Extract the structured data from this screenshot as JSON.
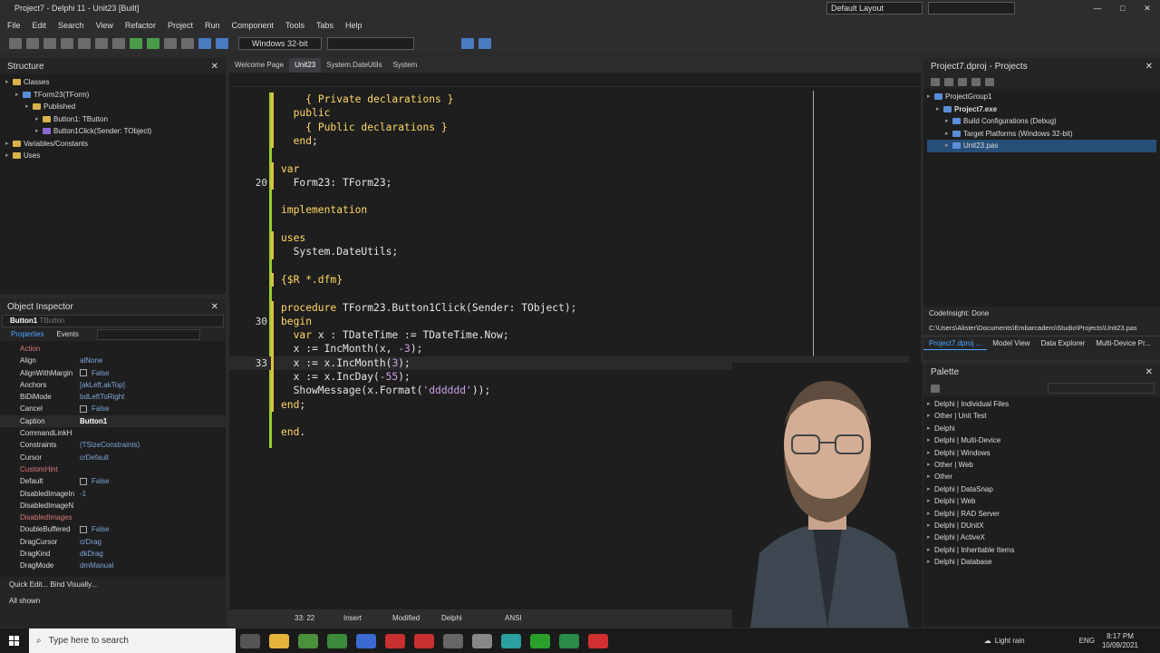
{
  "window": {
    "title": "Project7 - Delphi 11 - Unit23 [Built]",
    "layout": "Default Layout"
  },
  "menu": [
    "File",
    "Edit",
    "Search",
    "View",
    "Refactor",
    "Project",
    "Run",
    "Component",
    "Tools",
    "Tabs",
    "Help"
  ],
  "toolbar": {
    "platform": "Windows 32-bit"
  },
  "structure": {
    "title": "Structure",
    "items": [
      {
        "label": "Classes",
        "depth": 0,
        "icon": "folder"
      },
      {
        "label": "TForm23(TForm)",
        "depth": 1,
        "icon": "class"
      },
      {
        "label": "Published",
        "depth": 2,
        "icon": "folder"
      },
      {
        "label": "Button1: TButton",
        "depth": 3,
        "icon": "folder"
      },
      {
        "label": "Button1Click(Sender: TObject)",
        "depth": 3,
        "icon": "method"
      },
      {
        "label": "Variables/Constants",
        "depth": 0,
        "icon": "folder"
      },
      {
        "label": "Uses",
        "depth": 0,
        "icon": "folder"
      }
    ]
  },
  "inspector": {
    "title": "Object Inspector",
    "object": "Button1",
    "object_type": "TButton",
    "tab_properties": "Properties",
    "tab_events": "Events",
    "props": [
      {
        "name": "Action",
        "value": "",
        "event": true
      },
      {
        "name": "Align",
        "value": "alNone"
      },
      {
        "name": "AlignWithMargin",
        "value": "False",
        "check": true
      },
      {
        "name": "Anchors",
        "value": "[akLeft,akTop]"
      },
      {
        "name": "BiDiMode",
        "value": "bdLeftToRight"
      },
      {
        "name": "Cancel",
        "value": "False",
        "check": true
      },
      {
        "name": "Caption",
        "value": "Button1",
        "bold": true
      },
      {
        "name": "CommandLinkH",
        "value": ""
      },
      {
        "name": "Constraints",
        "value": "(TSizeConstraints)"
      },
      {
        "name": "Cursor",
        "value": "crDefault"
      },
      {
        "name": "CustomHint",
        "value": "",
        "event": true
      },
      {
        "name": "Default",
        "value": "False",
        "check": true
      },
      {
        "name": "DisabledImageIn",
        "value": "-1"
      },
      {
        "name": "DisabledImageN",
        "value": ""
      },
      {
        "name": "DisabledImages",
        "value": "",
        "event": true
      },
      {
        "name": "DoubleBuffered",
        "value": "False",
        "check": true
      },
      {
        "name": "DragCursor",
        "value": "crDrag"
      },
      {
        "name": "DragKind",
        "value": "dkDrag"
      },
      {
        "name": "DragMode",
        "value": "dmManual"
      }
    ],
    "quick": "Quick Edit...  Bind Visually...",
    "status": "All shown"
  },
  "editor": {
    "tabs": [
      "Welcome Page",
      "Unit23",
      "System.DateUtils",
      "System"
    ],
    "lines": [
      {
        "n": "",
        "html": "    <span class='cm'>{ Private declarations }</span>"
      },
      {
        "n": "",
        "html": "  <span class='kw'>public</span>"
      },
      {
        "n": "",
        "html": "    <span class='cm'>{ Public declarations }</span>"
      },
      {
        "n": "",
        "html": "  <span class='kw'>end</span>;"
      },
      {
        "n": "",
        "html": ""
      },
      {
        "n": "",
        "html": "<span class='kw'>var</span>"
      },
      {
        "n": "20",
        "html": "  Form23: TForm23;"
      },
      {
        "n": "",
        "html": ""
      },
      {
        "n": "",
        "html": "<span class='kw'>implementation</span>"
      },
      {
        "n": "",
        "html": ""
      },
      {
        "n": "",
        "html": "<span class='kw'>uses</span>"
      },
      {
        "n": "",
        "html": "  System.DateUtils;"
      },
      {
        "n": "",
        "html": ""
      },
      {
        "n": "",
        "html": "<span class='dr'>{$R *.dfm}</span>"
      },
      {
        "n": "",
        "html": ""
      },
      {
        "n": "",
        "html": "<span class='kw'>procedure</span> TForm23.Button1Click(Sender: TObject);"
      },
      {
        "n": "30",
        "html": "<span class='kw'>begin</span>"
      },
      {
        "n": "",
        "html": "  <span class='kw'>var</span> x : TDateTime := TDateTime.Now;"
      },
      {
        "n": "",
        "html": "  x := IncMonth(x, <span class='nm'>-3</span>);"
      },
      {
        "n": "33",
        "html": "  x := x.IncMonth(<span class='nm'>3</span>);"
      },
      {
        "n": "",
        "html": "  x := x.IncDay(<span class='nm'>-55</span>);"
      },
      {
        "n": "",
        "html": "  ShowMessage(x.Format(<span class='st'>'dddddd'</span>));"
      },
      {
        "n": "",
        "html": "<span class='kw'>end</span>;"
      },
      {
        "n": "",
        "html": ""
      },
      {
        "n": "",
        "html": "<span class='kw'>end</span>."
      }
    ],
    "status": {
      "pos": "33: 22",
      "mode": "Insert",
      "state": "Modified",
      "lang": "Delphi",
      "enc": "ANSI"
    }
  },
  "projects": {
    "title": "Project7.dproj - Projects",
    "items": [
      {
        "label": "ProjectGroup1",
        "depth": 0
      },
      {
        "label": "Project7.exe",
        "depth": 1,
        "bold": true
      },
      {
        "label": "Build Configurations (Debug)",
        "depth": 2
      },
      {
        "label": "Target Platforms (Windows 32-bit)",
        "depth": 2
      },
      {
        "label": "Unit23.pas",
        "depth": 2,
        "sel": true
      }
    ],
    "codeinsight": "CodeInsight: Done",
    "path": "C:\\Users\\Alister\\Documents\\Embarcadero\\Studio\\Projects\\Unit23.pas",
    "tabs": [
      "Project7.dproj ...",
      "Model View",
      "Data Explorer",
      "Multi-Device Pr..."
    ]
  },
  "palette": {
    "title": "Palette",
    "items": [
      "Delphi | Individual Files",
      "Other | Unit Test",
      "Delphi",
      "Delphi | Multi-Device",
      "Delphi | Windows",
      "Other | Web",
      "Other",
      "Delphi | DataSnap",
      "Delphi | Web",
      "Delphi | RAD Server",
      "Delphi | DUnitX",
      "Delphi | ActiveX",
      "Delphi | Inheritable Items",
      "Delphi | Database"
    ]
  },
  "taskbar": {
    "search": "Type here to search",
    "weather": "Light rain",
    "lang": "ENG",
    "time": "8:17 PM",
    "date": "10/09/2021"
  }
}
